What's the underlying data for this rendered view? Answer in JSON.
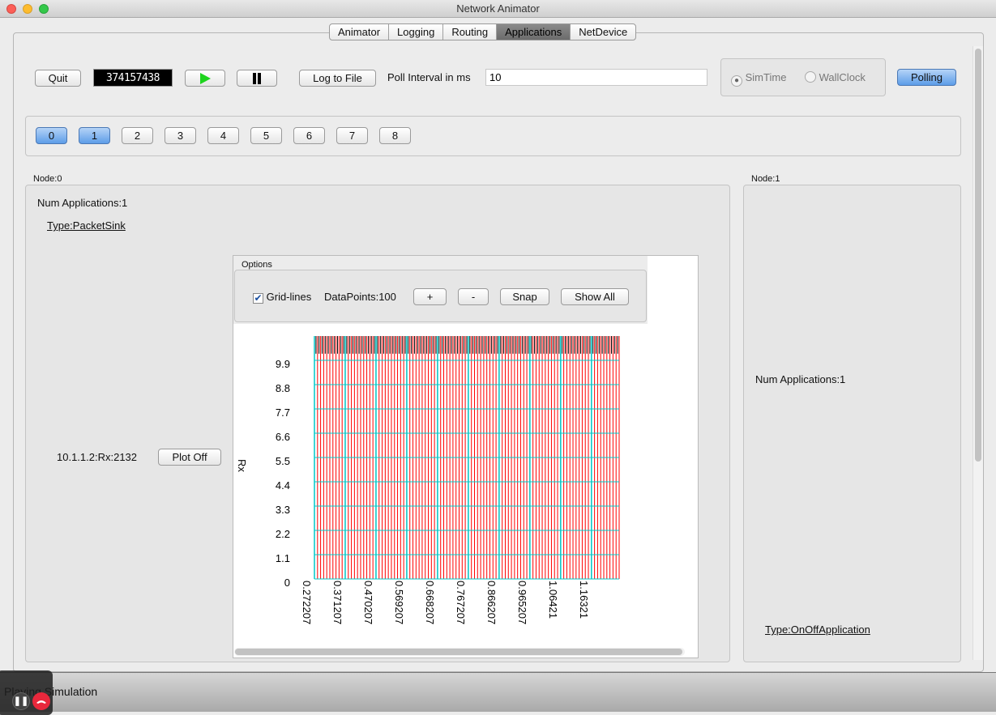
{
  "window": {
    "title": "Network Animator"
  },
  "tabs": [
    {
      "label": "Animator"
    },
    {
      "label": "Logging"
    },
    {
      "label": "Routing"
    },
    {
      "label": "Applications",
      "selected": true
    },
    {
      "label": "NetDevice"
    }
  ],
  "toolbar": {
    "quit": "Quit",
    "time_display": "374157438",
    "play_icon": "play-icon",
    "pause_icon": "pause-icon",
    "log_to_file": "Log to File",
    "poll_label": "Poll Interval in ms",
    "poll_value": "10",
    "sim_time": "SimTime",
    "wall_clock": "WallClock",
    "time_mode_selected": "SimTime",
    "polling": "Polling"
  },
  "nodes": {
    "buttons": [
      "0",
      "1",
      "2",
      "3",
      "4",
      "5",
      "6",
      "7",
      "8"
    ],
    "selected": [
      "0",
      "1"
    ]
  },
  "node0": {
    "title": "Node:0",
    "num_apps": "Num Applications:1",
    "type": "Type:PacketSink",
    "rx": "10.1.1.2:Rx:2132",
    "plot_off": "Plot Off"
  },
  "node1": {
    "title": "Node:1",
    "num_apps": "Num Applications:1",
    "type": "Type:OnOffApplication"
  },
  "plot": {
    "options_title": "Options",
    "gridlines": "Grid-lines",
    "gridlines_checked": true,
    "datapoints": "DataPoints:100",
    "plus": "+",
    "minus": "-",
    "snap": "Snap",
    "show_all": "Show All"
  },
  "status": {
    "text": "Playing Simulation"
  },
  "colors": {
    "impulse": "#ff0000",
    "grid": "#00c8c8",
    "accent": "#5d9de8"
  },
  "chart_data": {
    "type": "bar",
    "ylabel": "Rx",
    "grid": true,
    "yticks": [
      "0",
      "1.1",
      "2.2",
      "3.3",
      "4.4",
      "5.5",
      "6.6",
      "7.7",
      "8.8",
      "9.9"
    ],
    "xticks": [
      "0.272207",
      "0.371207",
      "0.470207",
      "0.569207",
      "0.668207",
      "0.767207",
      "0.866207",
      "0.965207",
      "1.06421",
      "1.16321"
    ],
    "ylim": [
      0,
      11
    ],
    "xlim": [
      0.272207,
      1.2523
    ],
    "x": [
      0.2722,
      0.2821,
      0.292,
      0.3019,
      0.3118,
      0.3217,
      0.3316,
      0.3415,
      0.3514,
      0.3613,
      0.3712,
      0.3811,
      0.391,
      0.4009,
      0.4108,
      0.4207,
      0.4306,
      0.4405,
      0.4504,
      0.4603,
      0.4702,
      0.4801,
      0.49,
      0.4999,
      0.5098,
      0.5197,
      0.5296,
      0.5395,
      0.5494,
      0.5593,
      0.5692,
      0.5791,
      0.589,
      0.5989,
      0.6088,
      0.6187,
      0.6286,
      0.6385,
      0.6484,
      0.6583,
      0.6682,
      0.6781,
      0.688,
      0.6979,
      0.7078,
      0.7177,
      0.7276,
      0.7375,
      0.7474,
      0.7573,
      0.7672,
      0.7771,
      0.787,
      0.7969,
      0.8068,
      0.8167,
      0.8266,
      0.8365,
      0.8464,
      0.8563,
      0.8662,
      0.8761,
      0.886,
      0.8959,
      0.9058,
      0.9157,
      0.9256,
      0.9355,
      0.9454,
      0.9553,
      0.9652,
      0.9751,
      0.985,
      0.9949,
      1.0048,
      1.0147,
      1.0246,
      1.0345,
      1.0444,
      1.0543,
      1.0642,
      1.0741,
      1.084,
      1.0939,
      1.1038,
      1.1137,
      1.1236,
      1.1335,
      1.1434,
      1.1533,
      1.1632,
      1.1731,
      1.183,
      1.1929,
      1.2028,
      1.2127,
      1.2226,
      1.2325,
      1.2424,
      1.2523
    ],
    "y_all": 11
  }
}
